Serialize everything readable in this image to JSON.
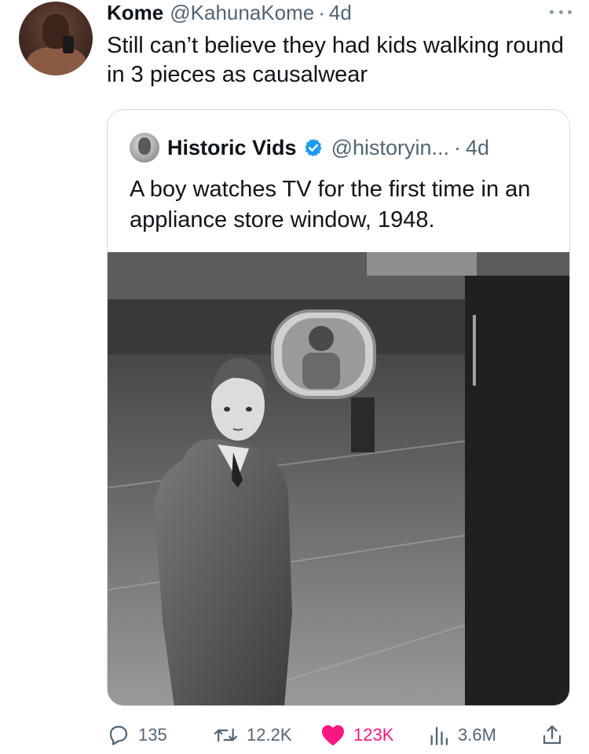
{
  "tweet": {
    "author_name": "Kome",
    "author_handle": "@KahunaKome",
    "separator": "·",
    "time": "4d",
    "text": "Still can’t believe they had kids walking round in 3 pieces as causalwear",
    "avatar_icon": "user-avatar",
    "more_icon": "more-dots-icon"
  },
  "quoted": {
    "author_name": "Historic Vids",
    "verified_icon": "verified-badge-icon",
    "author_handle": "@historyin...",
    "separator": "·",
    "time": "4d",
    "text": "A boy watches TV for the first time in an appliance store window, 1948.",
    "media": "black-and-white-photo"
  },
  "stats": {
    "replies": "135",
    "retweets": "12.2K",
    "likes": "123K",
    "views": "3.6M",
    "reply_icon": "reply-icon",
    "retweet_icon": "retweet-icon",
    "like_icon": "heart-icon",
    "views_icon": "views-bar-icon",
    "share_icon": "share-icon"
  },
  "colors": {
    "text_primary": "#0f1419",
    "text_secondary": "#536471",
    "like": "#f91880",
    "verified": "#1d9bf0",
    "border": "#cfd9de"
  }
}
